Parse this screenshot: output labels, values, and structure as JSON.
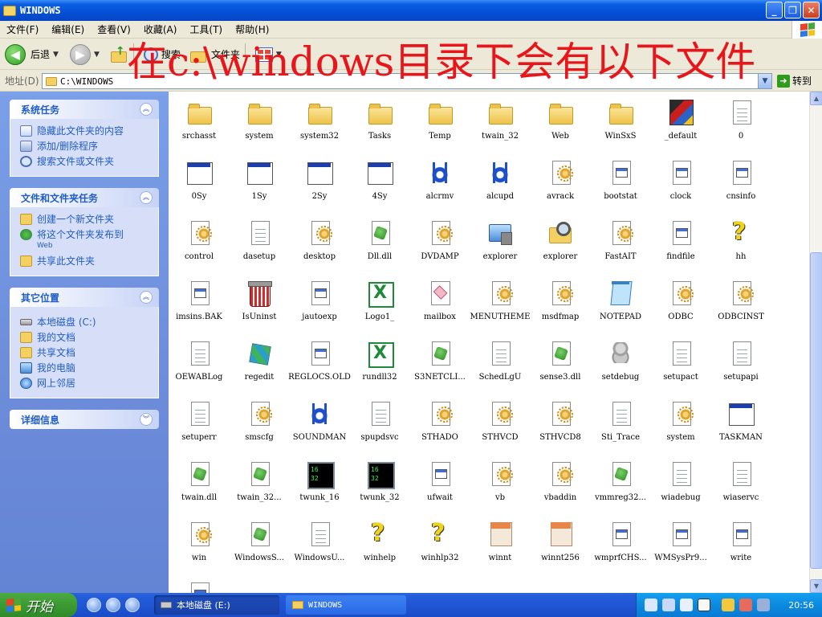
{
  "window": {
    "title": "WINDOWS",
    "buttons": [
      "_",
      "❐",
      "✕"
    ]
  },
  "menu": [
    "文件(F)",
    "编辑(E)",
    "查看(V)",
    "收藏(A)",
    "工具(T)",
    "帮助(H)"
  ],
  "toolbar": {
    "back_label": "后退",
    "search_label": "搜索",
    "folders_label": "文件夹"
  },
  "overlay_text": "在c:\\windows目录下会有以下文件",
  "address": {
    "label": "地址(D)",
    "value": "C:\\WINDOWS",
    "go_label": "转到"
  },
  "left_pane": {
    "panels": [
      {
        "title": "系统任务",
        "items": [
          {
            "label": "隐藏此文件夹的内容",
            "icon": "hide-icon"
          },
          {
            "label": "添加/删除程序",
            "icon": "programs-icon"
          },
          {
            "label": "搜索文件或文件夹",
            "icon": "search-icon"
          }
        ]
      },
      {
        "title": "文件和文件夹任务",
        "items": [
          {
            "label": "创建一个新文件夹",
            "icon": "new-folder-icon"
          },
          {
            "label": "将这个文件夹发布到",
            "sub": "Web",
            "icon": "publish-icon"
          },
          {
            "label": "共享此文件夹",
            "icon": "share-icon"
          }
        ]
      },
      {
        "title": "其它位置",
        "items": [
          {
            "label": "本地磁盘 (C:)",
            "icon": "drive-icon"
          },
          {
            "label": "我的文档",
            "icon": "documents-icon"
          },
          {
            "label": "共享文档",
            "icon": "shared-docs-icon"
          },
          {
            "label": "我的电脑",
            "icon": "computer-icon"
          },
          {
            "label": "网上邻居",
            "icon": "network-icon"
          }
        ]
      },
      {
        "title": "详细信息",
        "items": []
      }
    ]
  },
  "files": [
    {
      "name": "srchasst",
      "type": "folder"
    },
    {
      "name": "system",
      "type": "folder"
    },
    {
      "name": "system32",
      "type": "folder"
    },
    {
      "name": "Tasks",
      "type": "folder"
    },
    {
      "name": "Temp",
      "type": "folder"
    },
    {
      "name": "twain_32",
      "type": "folder"
    },
    {
      "name": "Web",
      "type": "folder"
    },
    {
      "name": "WinSxS",
      "type": "folder"
    },
    {
      "name": "_default",
      "type": "ms"
    },
    {
      "name": "0",
      "type": "doc"
    },
    {
      "name": "0Sy",
      "type": "window"
    },
    {
      "name": "1Sy",
      "type": "window"
    },
    {
      "name": "2Sy",
      "type": "window"
    },
    {
      "name": "4Sy",
      "type": "window"
    },
    {
      "name": "alcrmv",
      "type": "realtek"
    },
    {
      "name": "alcupd",
      "type": "realtek"
    },
    {
      "name": "avrack",
      "type": "gear"
    },
    {
      "name": "bootstat",
      "type": "exe"
    },
    {
      "name": "clock",
      "type": "exe"
    },
    {
      "name": "cnsinfo",
      "type": "exe"
    },
    {
      "name": "control",
      "type": "gear"
    },
    {
      "name": "dasetup",
      "type": "doc"
    },
    {
      "name": "desktop",
      "type": "gear"
    },
    {
      "name": "Dll.dll",
      "type": "dll"
    },
    {
      "name": "DVDAMP",
      "type": "gear"
    },
    {
      "name": "explorer",
      "type": "explorer"
    },
    {
      "name": "explorer",
      "type": "mag"
    },
    {
      "name": "FastAIT",
      "type": "gear"
    },
    {
      "name": "findfile",
      "type": "exe"
    },
    {
      "name": "hh",
      "type": "help"
    },
    {
      "name": "imsins.BAK",
      "type": "exe"
    },
    {
      "name": "IsUninst",
      "type": "uninst"
    },
    {
      "name": "jautoexp",
      "type": "exe"
    },
    {
      "name": "Logo1_",
      "type": "excel"
    },
    {
      "name": "mailbox",
      "type": "mailbox"
    },
    {
      "name": "MENUTHEME",
      "type": "gear"
    },
    {
      "name": "msdfmap",
      "type": "gear"
    },
    {
      "name": "NOTEPAD",
      "type": "notepad"
    },
    {
      "name": "ODBC",
      "type": "gear"
    },
    {
      "name": "ODBCINST",
      "type": "gear"
    },
    {
      "name": "OEWABLog",
      "type": "doc"
    },
    {
      "name": "regedit",
      "type": "regedit"
    },
    {
      "name": "REGLOCS.OLD",
      "type": "exe"
    },
    {
      "name": "rundll32",
      "type": "excel"
    },
    {
      "name": "S3NETCLI...",
      "type": "dll"
    },
    {
      "name": "SchedLgU",
      "type": "doc"
    },
    {
      "name": "sense3.dll",
      "type": "dll"
    },
    {
      "name": "setdebug",
      "type": "setdebug"
    },
    {
      "name": "setupact",
      "type": "doc"
    },
    {
      "name": "setupapi",
      "type": "doc"
    },
    {
      "name": "setuperr",
      "type": "doc"
    },
    {
      "name": "smscfg",
      "type": "gear"
    },
    {
      "name": "SOUNDMAN",
      "type": "realtek"
    },
    {
      "name": "spupdsvc",
      "type": "doc"
    },
    {
      "name": "STHADO",
      "type": "gear"
    },
    {
      "name": "STHVCD",
      "type": "gear"
    },
    {
      "name": "STHVCD8",
      "type": "gear"
    },
    {
      "name": "Sti_Trace",
      "type": "doc"
    },
    {
      "name": "system",
      "type": "gear"
    },
    {
      "name": "TASKMAN",
      "type": "window"
    },
    {
      "name": "twain.dll",
      "type": "dll"
    },
    {
      "name": "twain_32...",
      "type": "dll"
    },
    {
      "name": "twunk_16",
      "type": "dos"
    },
    {
      "name": "twunk_32",
      "type": "dos"
    },
    {
      "name": "ufwait",
      "type": "exe"
    },
    {
      "name": "vb",
      "type": "gear"
    },
    {
      "name": "vbaddin",
      "type": "gear"
    },
    {
      "name": "vmmreg32...",
      "type": "dll"
    },
    {
      "name": "wiadebug",
      "type": "doc"
    },
    {
      "name": "wiaservc",
      "type": "doc"
    },
    {
      "name": "win",
      "type": "gear"
    },
    {
      "name": "WindowsS...",
      "type": "dll"
    },
    {
      "name": "WindowsU...",
      "type": "doc"
    },
    {
      "name": "winhelp",
      "type": "help"
    },
    {
      "name": "winhlp32",
      "type": "help"
    },
    {
      "name": "winnt",
      "type": "bmp"
    },
    {
      "name": "winnt256",
      "type": "bmp"
    },
    {
      "name": "wmprfCHS...",
      "type": "exe"
    },
    {
      "name": "WMSysPr9...",
      "type": "exe"
    },
    {
      "name": "write",
      "type": "exe"
    },
    {
      "name": "",
      "type": "exe"
    }
  ],
  "taskbar": {
    "start_label": "开始",
    "tasks": [
      {
        "label": "本地磁盘 (E:)",
        "icon": "drive-icon"
      },
      {
        "label": "WINDOWS",
        "icon": "folder-icon"
      }
    ],
    "clock": "20:56"
  },
  "colors": {
    "title_blue": "#0550d6",
    "overlay_red": "#e8161b",
    "task_pane_blue": "#6f8fdc",
    "start_green": "#3c9a33"
  }
}
